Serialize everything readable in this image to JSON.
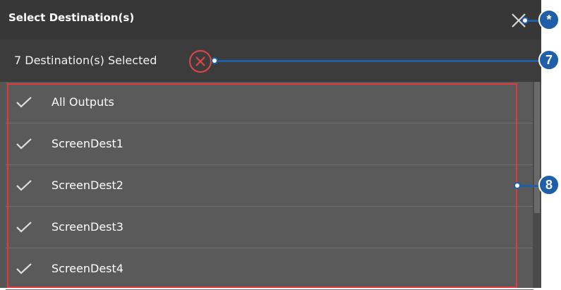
{
  "dialog": {
    "title": "Select Destination(s)",
    "selected_text": "7 Destination(s) Selected"
  },
  "list": {
    "items": [
      {
        "label": "All Outputs",
        "checked": true
      },
      {
        "label": "ScreenDest1",
        "checked": true
      },
      {
        "label": "ScreenDest2",
        "checked": true
      },
      {
        "label": "ScreenDest3",
        "checked": true
      },
      {
        "label": "ScreenDest4",
        "checked": true
      }
    ]
  },
  "callouts": {
    "close": "*",
    "clear": "7",
    "list": "8"
  },
  "colors": {
    "callout_blue": "#1f5ea8",
    "highlight_red": "#e0393e",
    "clear_icon_red": "#e24646"
  },
  "icons": {
    "close": "close-icon",
    "clear": "clear-selection-icon",
    "check": "checkmark-icon"
  }
}
